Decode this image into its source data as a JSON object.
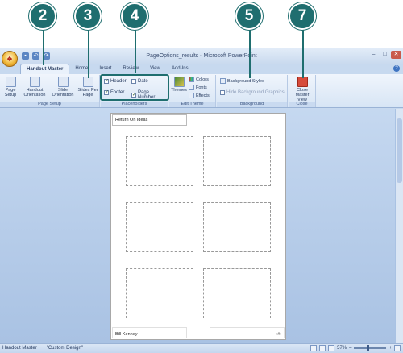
{
  "callouts": [
    "2",
    "3",
    "4",
    "5",
    "7"
  ],
  "window": {
    "title": "PageOptions_results - Microsoft PowerPoint",
    "help": "?"
  },
  "tabs": [
    "Handout Master",
    "Home",
    "Insert",
    "Review",
    "View",
    "Add-Ins"
  ],
  "ribbon": {
    "page_setup": {
      "page_setup_btn": "Page Setup",
      "handout_orientation": "Handout Orientation",
      "slide_orientation": "Slide Orientation",
      "slides_per_page": "Slides Per Page",
      "label": "Page Setup"
    },
    "placeholders": {
      "header": "Header",
      "date": "Date",
      "footer": "Footer",
      "page_number": "Page Number",
      "label": "Placeholders"
    },
    "edit_theme": {
      "themes": "Themes",
      "colors": "Colors",
      "fonts": "Fonts",
      "effects": "Effects",
      "label": "Edit Theme"
    },
    "background": {
      "background_styles": "Background Styles",
      "hide_bg_graphics": "Hide Background Graphics",
      "label": "Background"
    },
    "close": {
      "close_master_view": "Close Master View",
      "label": "Close"
    }
  },
  "page": {
    "header_text": "Return On Ideas",
    "footer_text": "Bill Kenney",
    "page_number_mark": "‹#›"
  },
  "status": {
    "view": "Handout Master",
    "theme": "\"Custom Design\"",
    "zoom": "57%"
  }
}
